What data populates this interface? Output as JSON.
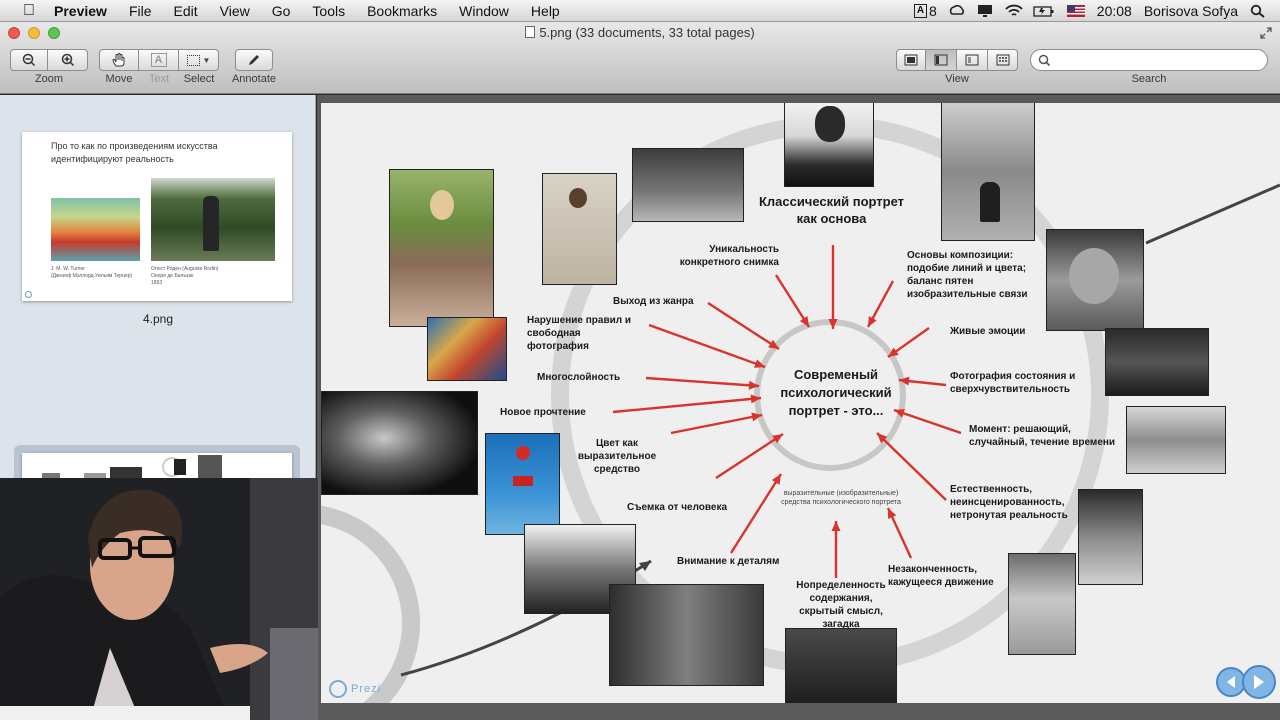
{
  "menubar": {
    "app_name": "Preview",
    "items": [
      "File",
      "Edit",
      "View",
      "Go",
      "Tools",
      "Bookmarks",
      "Window",
      "Help"
    ],
    "status": {
      "input_badge": "8",
      "time": "20:08",
      "user": "Borisova Sofya"
    }
  },
  "window": {
    "title": "5.png (33 documents, 33 total pages)"
  },
  "toolbar": {
    "zoom_label": "Zoom",
    "move_label": "Move",
    "text_label": "Text",
    "select_label": "Select",
    "annotate_label": "Annotate",
    "view_label": "View",
    "search_label": "Search",
    "search_placeholder": ""
  },
  "sidebar": {
    "thumb1": {
      "title": "Про то как по произведениям искусства идентифицируют реальность",
      "caption_left_1": "J. M. W. Turner",
      "caption_left_2": "(Джозеф Мэллорд Уильям Тернер)",
      "caption_right_1": "Огюст Роден (Auguste Rodin)",
      "caption_right_2": "Оноре де Бальзак",
      "caption_right_3": "1893",
      "label": "4.png"
    }
  },
  "slide": {
    "top_heading": "Классический портрет как основа",
    "center": "Современый психологический портрет - это...",
    "sub_center": "выразительные (изобразительные) средства психологического портрета",
    "labels": {
      "uniqueness": "Уникальность конкретного снимка",
      "composition": "Основы композиции: подобие линий и цвета; баланс пятен изобразительные связи",
      "genre": "Выход из жанра",
      "rules": "Нарушение правил и свободная фотография",
      "emotions": "Живые эмоции",
      "layers": "Многослойность",
      "state": "Фотография состояния и сверхчувствительность",
      "reading": "Новое прочтение",
      "moment": "Момент: решающий, случайный, течение времени",
      "color": "Цвет как выразительное средство",
      "person": "Съемка от человека",
      "natural": "Естественность, неинсценированность, нетронутая реальность",
      "details": "Внимание к деталям",
      "unfinished": "Незаконченность, кажущееся движение",
      "uncertainty": "Нопределенность содержания, скрытый смысл, загадка"
    },
    "logo": "Prezi"
  },
  "colors": {
    "arrow_red": "#d9342b",
    "sidebar_bg": "#dde3eb",
    "slide_bg": "#efefef"
  }
}
